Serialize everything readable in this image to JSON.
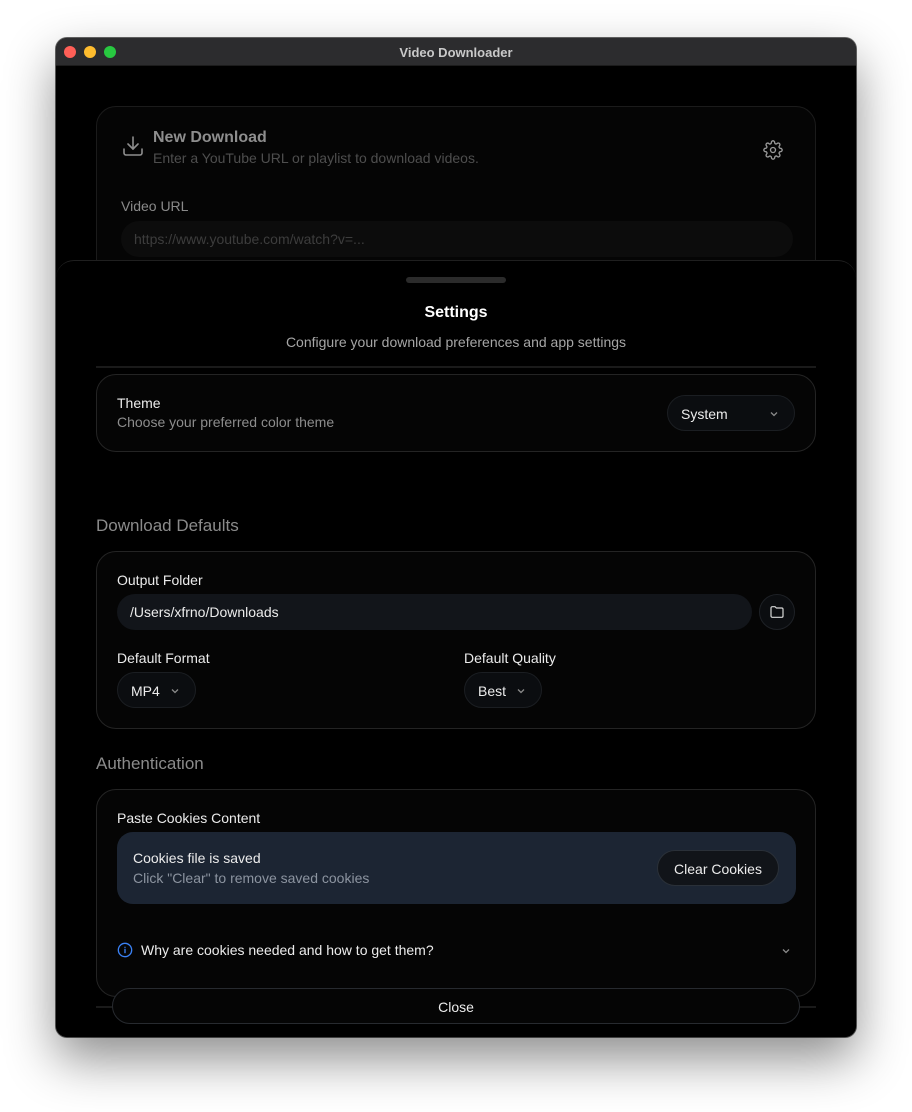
{
  "window": {
    "title": "Video Downloader"
  },
  "background_card": {
    "title": "New Download",
    "subtitle": "Enter a YouTube URL or playlist to download videos.",
    "url_label": "Video URL",
    "url_placeholder": "https://www.youtube.com/watch?v=..."
  },
  "settings": {
    "title": "Settings",
    "subtitle": "Configure your download preferences and app settings",
    "theme": {
      "label": "Theme",
      "description": "Choose your preferred color theme",
      "value": "System"
    },
    "download_defaults": {
      "heading": "Download Defaults",
      "output_folder_label": "Output Folder",
      "output_folder_value": "/Users/xfrno/Downloads",
      "format_label": "Default Format",
      "format_value": "MP4",
      "quality_label": "Default Quality",
      "quality_value": "Best"
    },
    "authentication": {
      "heading": "Authentication",
      "cookies_label": "Paste Cookies Content",
      "status_title": "Cookies file is saved",
      "status_sub": "Click \"Clear\" to remove saved cookies",
      "clear_button": "Clear Cookies",
      "faq_text": "Why are cookies needed and how to get them?"
    },
    "close_button": "Close"
  },
  "colors": {
    "accent_info": "#3b82f6",
    "cookie_panel": "#1c2533"
  },
  "icons": [
    "download-icon",
    "gear-icon",
    "chevron-down-icon",
    "folder-icon",
    "info-icon"
  ]
}
